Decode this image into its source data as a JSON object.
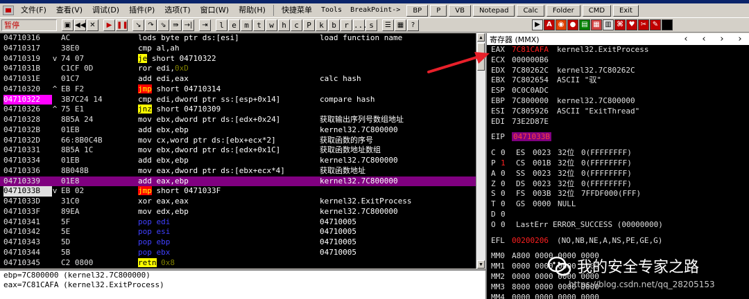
{
  "menu": {
    "items": [
      "文件(F)",
      "查看(V)",
      "调试(D)",
      "插件(P)",
      "选项(T)",
      "窗口(W)",
      "帮助(H)"
    ],
    "quick_menu": "快捷菜单",
    "tools": "Tools",
    "breakpoint": "BreakPoint->",
    "buttons": [
      "BP",
      "P",
      "VB",
      "Notepad",
      "Calc",
      "Folder",
      "CMD",
      "Exit"
    ]
  },
  "toolbar": {
    "status": "暂停",
    "letters": [
      "l",
      "e",
      "m",
      "t",
      "w",
      "h",
      "c",
      "P",
      "k",
      "b",
      "r",
      "...",
      "s"
    ]
  },
  "disasm": {
    "rows": [
      {
        "addr": "04710316",
        "mark": "",
        "hex": "AC",
        "mn": "lods",
        "ops": "byte ptr ds:[esi]",
        "cmt": "load function name",
        "style": "plain"
      },
      {
        "addr": "04710317",
        "mark": "",
        "hex": "38E0",
        "mn": "cmp",
        "ops": "al,ah",
        "cmt": "",
        "style": "plain"
      },
      {
        "addr": "04710319",
        "mark": "v",
        "hex": "74 07",
        "mn": "je",
        "ops": "short 04710322",
        "cmt": "",
        "style": "jcc"
      },
      {
        "addr": "0471031B",
        "mark": "",
        "hex": "C1CF 0D",
        "mn": "ror",
        "ops": "edi,",
        "imm": "0xD",
        "cmt": "",
        "style": "plain"
      },
      {
        "addr": "0471031E",
        "mark": "",
        "hex": "01C7",
        "mn": "add",
        "ops": "edi,eax",
        "cmt": "calc hash",
        "style": "plain"
      },
      {
        "addr": "04710320",
        "mark": "^",
        "hex": "EB F2",
        "mn": "jmp",
        "ops": "short 04710314",
        "cmt": "",
        "style": "jmp"
      },
      {
        "addr": "04710322",
        "mark": "",
        "hex": "3B7C24 14",
        "mn": "cmp",
        "ops": "edi,dword ptr ss:[esp+0x14]",
        "cmt": "compare hash",
        "style": "plain",
        "addrhl": true
      },
      {
        "addr": "04710326",
        "mark": "^",
        "hex": "75 E1",
        "mn": "jnz",
        "ops": "short 04710309",
        "cmt": "",
        "style": "jcc"
      },
      {
        "addr": "04710328",
        "mark": "",
        "hex": "8B5A 24",
        "mn": "mov",
        "ops": "ebx,dword ptr ds:[edx+0x24]",
        "cmt": "获取输出序列号数组地址",
        "style": "plain"
      },
      {
        "addr": "0471032B",
        "mark": "",
        "hex": "01EB",
        "mn": "add",
        "ops": "ebx,ebp",
        "cmt": "kernel32.7C800000",
        "style": "plain"
      },
      {
        "addr": "0471032D",
        "mark": "",
        "hex": "66:8B0C4B",
        "mn": "mov",
        "ops": "cx,word ptr ds:[ebx+ecx*2]",
        "cmt": "获取函数的序号",
        "style": "plain"
      },
      {
        "addr": "04710331",
        "mark": "",
        "hex": "8B5A 1C",
        "mn": "mov",
        "ops": "ebx,dword ptr ds:[edx+0x1C]",
        "cmt": "获取函数地址数组",
        "style": "plain"
      },
      {
        "addr": "04710334",
        "mark": "",
        "hex": "01EB",
        "mn": "add",
        "ops": "ebx,ebp",
        "cmt": "kernel32.7C800000",
        "style": "plain"
      },
      {
        "addr": "04710336",
        "mark": "",
        "hex": "8B048B",
        "mn": "mov",
        "ops": "eax,dword ptr ds:[ebx+ecx*4]",
        "cmt": "获取函数地址",
        "style": "plain"
      },
      {
        "addr": "04710339",
        "mark": "",
        "hex": "01E8",
        "mn": "add",
        "ops": "eax,ebp",
        "cmt": "kernel32.7C800000",
        "style": "plain",
        "sel": true
      },
      {
        "addr": "0471033B",
        "mark": "v",
        "hex": "EB 02",
        "mn": "jmp",
        "ops": "short 0471033F",
        "cmt": "",
        "style": "jmp",
        "addrbox": true
      },
      {
        "addr": "0471033D",
        "mark": "",
        "hex": "31C0",
        "mn": "xor",
        "ops": "eax,eax",
        "cmt": "kernel32.ExitProcess",
        "style": "plain"
      },
      {
        "addr": "0471033F",
        "mark": "",
        "hex": "89EA",
        "mn": "mov",
        "ops": "edx,ebp",
        "cmt": "kernel32.7C800000",
        "style": "plain"
      },
      {
        "addr": "04710341",
        "mark": "",
        "hex": "5F",
        "mn": "pop",
        "ops": "edi",
        "cmt": "04710005",
        "style": "pop"
      },
      {
        "addr": "04710342",
        "mark": "",
        "hex": "5E",
        "mn": "pop",
        "ops": "esi",
        "cmt": "04710005",
        "style": "pop"
      },
      {
        "addr": "04710343",
        "mark": "",
        "hex": "5D",
        "mn": "pop",
        "ops": "ebp",
        "cmt": "04710005",
        "style": "pop"
      },
      {
        "addr": "04710344",
        "mark": "",
        "hex": "5B",
        "mn": "pop",
        "ops": "ebx",
        "cmt": "04710005",
        "style": "pop"
      },
      {
        "addr": "04710345",
        "mark": "",
        "hex": "C2 0800",
        "mn": "retn",
        "ops": "",
        "imm": "0x8",
        "cmt": "",
        "style": "ret"
      }
    ]
  },
  "info": {
    "line1": "ebp=7C800000 (kernel32.7C800000)",
    "line2": "eax=7C81CAFA (kernel32.ExitProcess)"
  },
  "registers": {
    "header": "寄存器 (MMX)",
    "general": [
      {
        "name": "EAX",
        "value": "7C81CAFA",
        "desc": "kernel32.ExitProcess",
        "changed": true
      },
      {
        "name": "ECX",
        "value": "000000B6",
        "desc": ""
      },
      {
        "name": "EDX",
        "value": "7C80262C",
        "desc": "kernel32.7C80262C"
      },
      {
        "name": "EBX",
        "value": "7C802654",
        "desc": "ASCII \"驭\""
      },
      {
        "name": "ESP",
        "value": "0C0C0ADC",
        "desc": ""
      },
      {
        "name": "EBP",
        "value": "7C800000",
        "desc": "kernel32.7C800000"
      },
      {
        "name": "ESI",
        "value": "7C805926",
        "desc": "ASCII \"ExitThread\""
      },
      {
        "name": "EDI",
        "value": "73E2D87E",
        "desc": ""
      }
    ],
    "eip": {
      "name": "EIP",
      "value": "0471033B"
    },
    "flags": [
      {
        "f": "C",
        "v": "0",
        "seg": "ES",
        "sv": "0023",
        "bits": "32位",
        "rest": "0(FFFFFFFF)"
      },
      {
        "f": "P",
        "v": "1",
        "seg": "CS",
        "sv": "001B",
        "bits": "32位",
        "rest": "0(FFFFFFFF)",
        "red": true
      },
      {
        "f": "A",
        "v": "0",
        "seg": "SS",
        "sv": "0023",
        "bits": "32位",
        "rest": "0(FFFFFFFF)"
      },
      {
        "f": "Z",
        "v": "0",
        "seg": "DS",
        "sv": "0023",
        "bits": "32位",
        "rest": "0(FFFFFFFF)"
      },
      {
        "f": "S",
        "v": "0",
        "seg": "FS",
        "sv": "003B",
        "bits": "32位",
        "rest": "7FFDF000(FFF)"
      },
      {
        "f": "T",
        "v": "0",
        "seg": "GS",
        "sv": "0000",
        "bits": "",
        "rest": "NULL"
      },
      {
        "f": "D",
        "v": "0",
        "seg": "",
        "sv": "",
        "bits": "",
        "rest": ""
      },
      {
        "f": "O",
        "v": "0",
        "seg": "",
        "sv": "",
        "bits": "",
        "rest": "LastErr ERROR_SUCCESS (00000000)"
      }
    ],
    "efl": {
      "name": "EFL",
      "value": "00200206",
      "desc": "(NO,NB,NE,A,NS,PE,GE,G)"
    },
    "mmx": [
      {
        "name": "MM0",
        "value": "A800 0000 0000 0000"
      },
      {
        "name": "MM1",
        "value": "0000 0000 0000 0000"
      },
      {
        "name": "MM2",
        "value": "0000 0000 0000 0000"
      },
      {
        "name": "MM3",
        "value": "8000 0000 0000 0000"
      },
      {
        "name": "MM4",
        "value": "0000 0000 0000 0000"
      }
    ]
  },
  "watermark": {
    "text": "我的安全专家之路",
    "url": "https://blog.csdn.net/qq_28205153"
  },
  "colors": {
    "selected_row": "#800080",
    "highlight_addr": "#ff00ff",
    "changed_value": "#ff2020",
    "jump_bg": "#ff0000",
    "jcc_bg": "#ffff00",
    "pop_color": "#4040ff",
    "annotation_arrow": "#e8202a"
  }
}
